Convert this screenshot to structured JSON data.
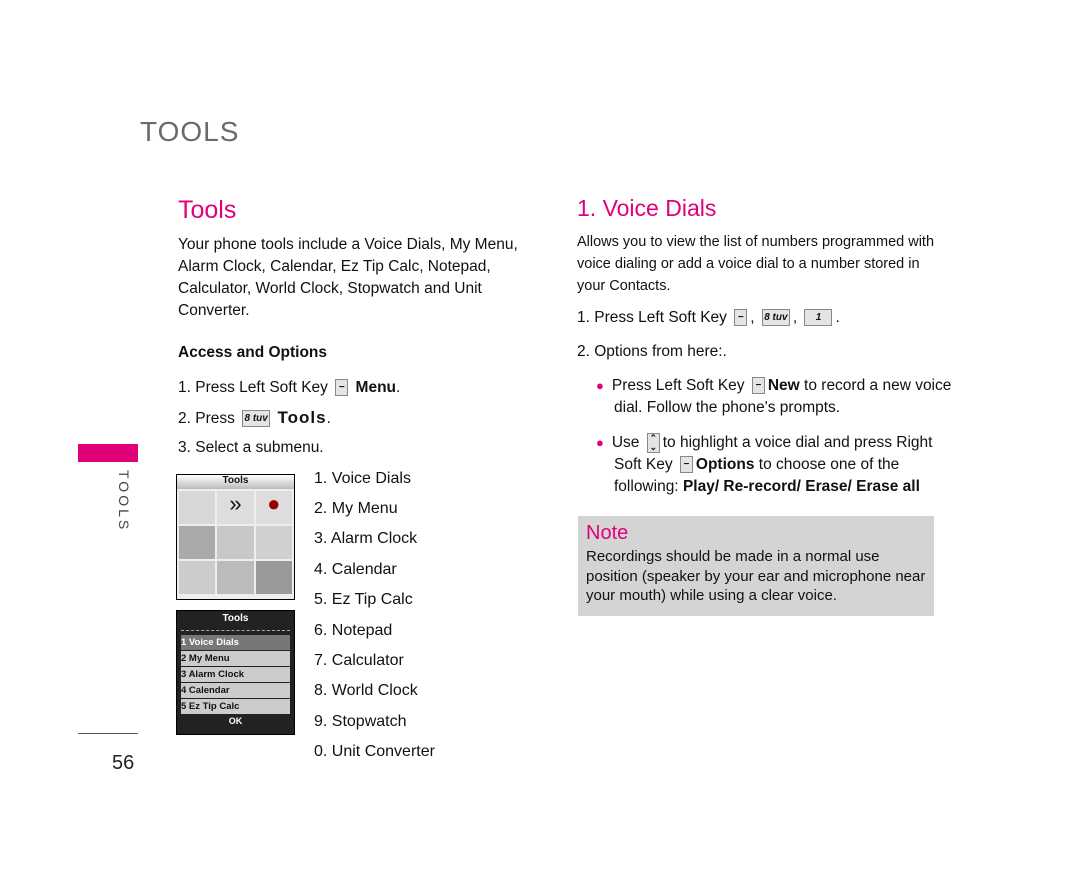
{
  "header": {
    "section": "TOOLS",
    "side_tab": "TOOLS",
    "page_number": "56"
  },
  "left": {
    "title": "Tools",
    "intro": "Your phone tools include a Voice Dials, My Menu, Alarm Clock, Calendar, Ez Tip Calc, Notepad, Calculator, World Clock, Stopwatch and Unit Converter.",
    "access_heading": "Access and Options",
    "step1_prefix": "1. Press Left Soft Key",
    "step1_bold": "Menu",
    "step1_suffix": ".",
    "step2_prefix": "2. Press",
    "step2_bold": "Tools",
    "step2_suffix": ".",
    "step3": "3. Select a submenu.",
    "key8": "8 tuv",
    "submenu": [
      "1. Voice Dials",
      "2. My Menu",
      "3. Alarm Clock",
      "4. Calendar",
      "5. Ez Tip Calc",
      "6. Notepad",
      "7. Calculator",
      "8. World Clock",
      "9. Stopwatch",
      "0. Unit Converter"
    ],
    "screen1": {
      "title": "Tools"
    },
    "screen2": {
      "title": "Tools",
      "items": [
        "1 Voice Dials",
        "2 My Menu",
        "3 Alarm Clock",
        "4 Calendar",
        "5 Ez Tip Calc"
      ],
      "softkey": "OK"
    }
  },
  "right": {
    "title": "1. Voice Dials",
    "intro": "Allows you to view the list of numbers programmed with voice dialing or add a voice dial  to a number stored in your Contacts.",
    "step1": "1. Press Left Soft Key",
    "key8": "8 tuv",
    "key1": "1",
    "step2": "2. Options from here:.",
    "bullet1_a": "Press Left Soft Key",
    "bullet1_bold": "New",
    "bullet1_b": "to record a new voice dial. Follow the phone's prompts.",
    "bullet2_a": "Use",
    "bullet2_b": "to highlight a voice dial and press Right Soft Key",
    "bullet2_bold": "Options",
    "bullet2_c": "to choose one of the following:",
    "bullet2_opts": "Play/ Re-record/ Erase/ Erase all",
    "note_title": "Note",
    "note_text": "Recordings should be made in a normal use position (speaker by your ear and microphone near your mouth) while using a clear voice."
  },
  "colors": {
    "accent": "#e0007a",
    "note_bg": "#d4d4d4"
  }
}
